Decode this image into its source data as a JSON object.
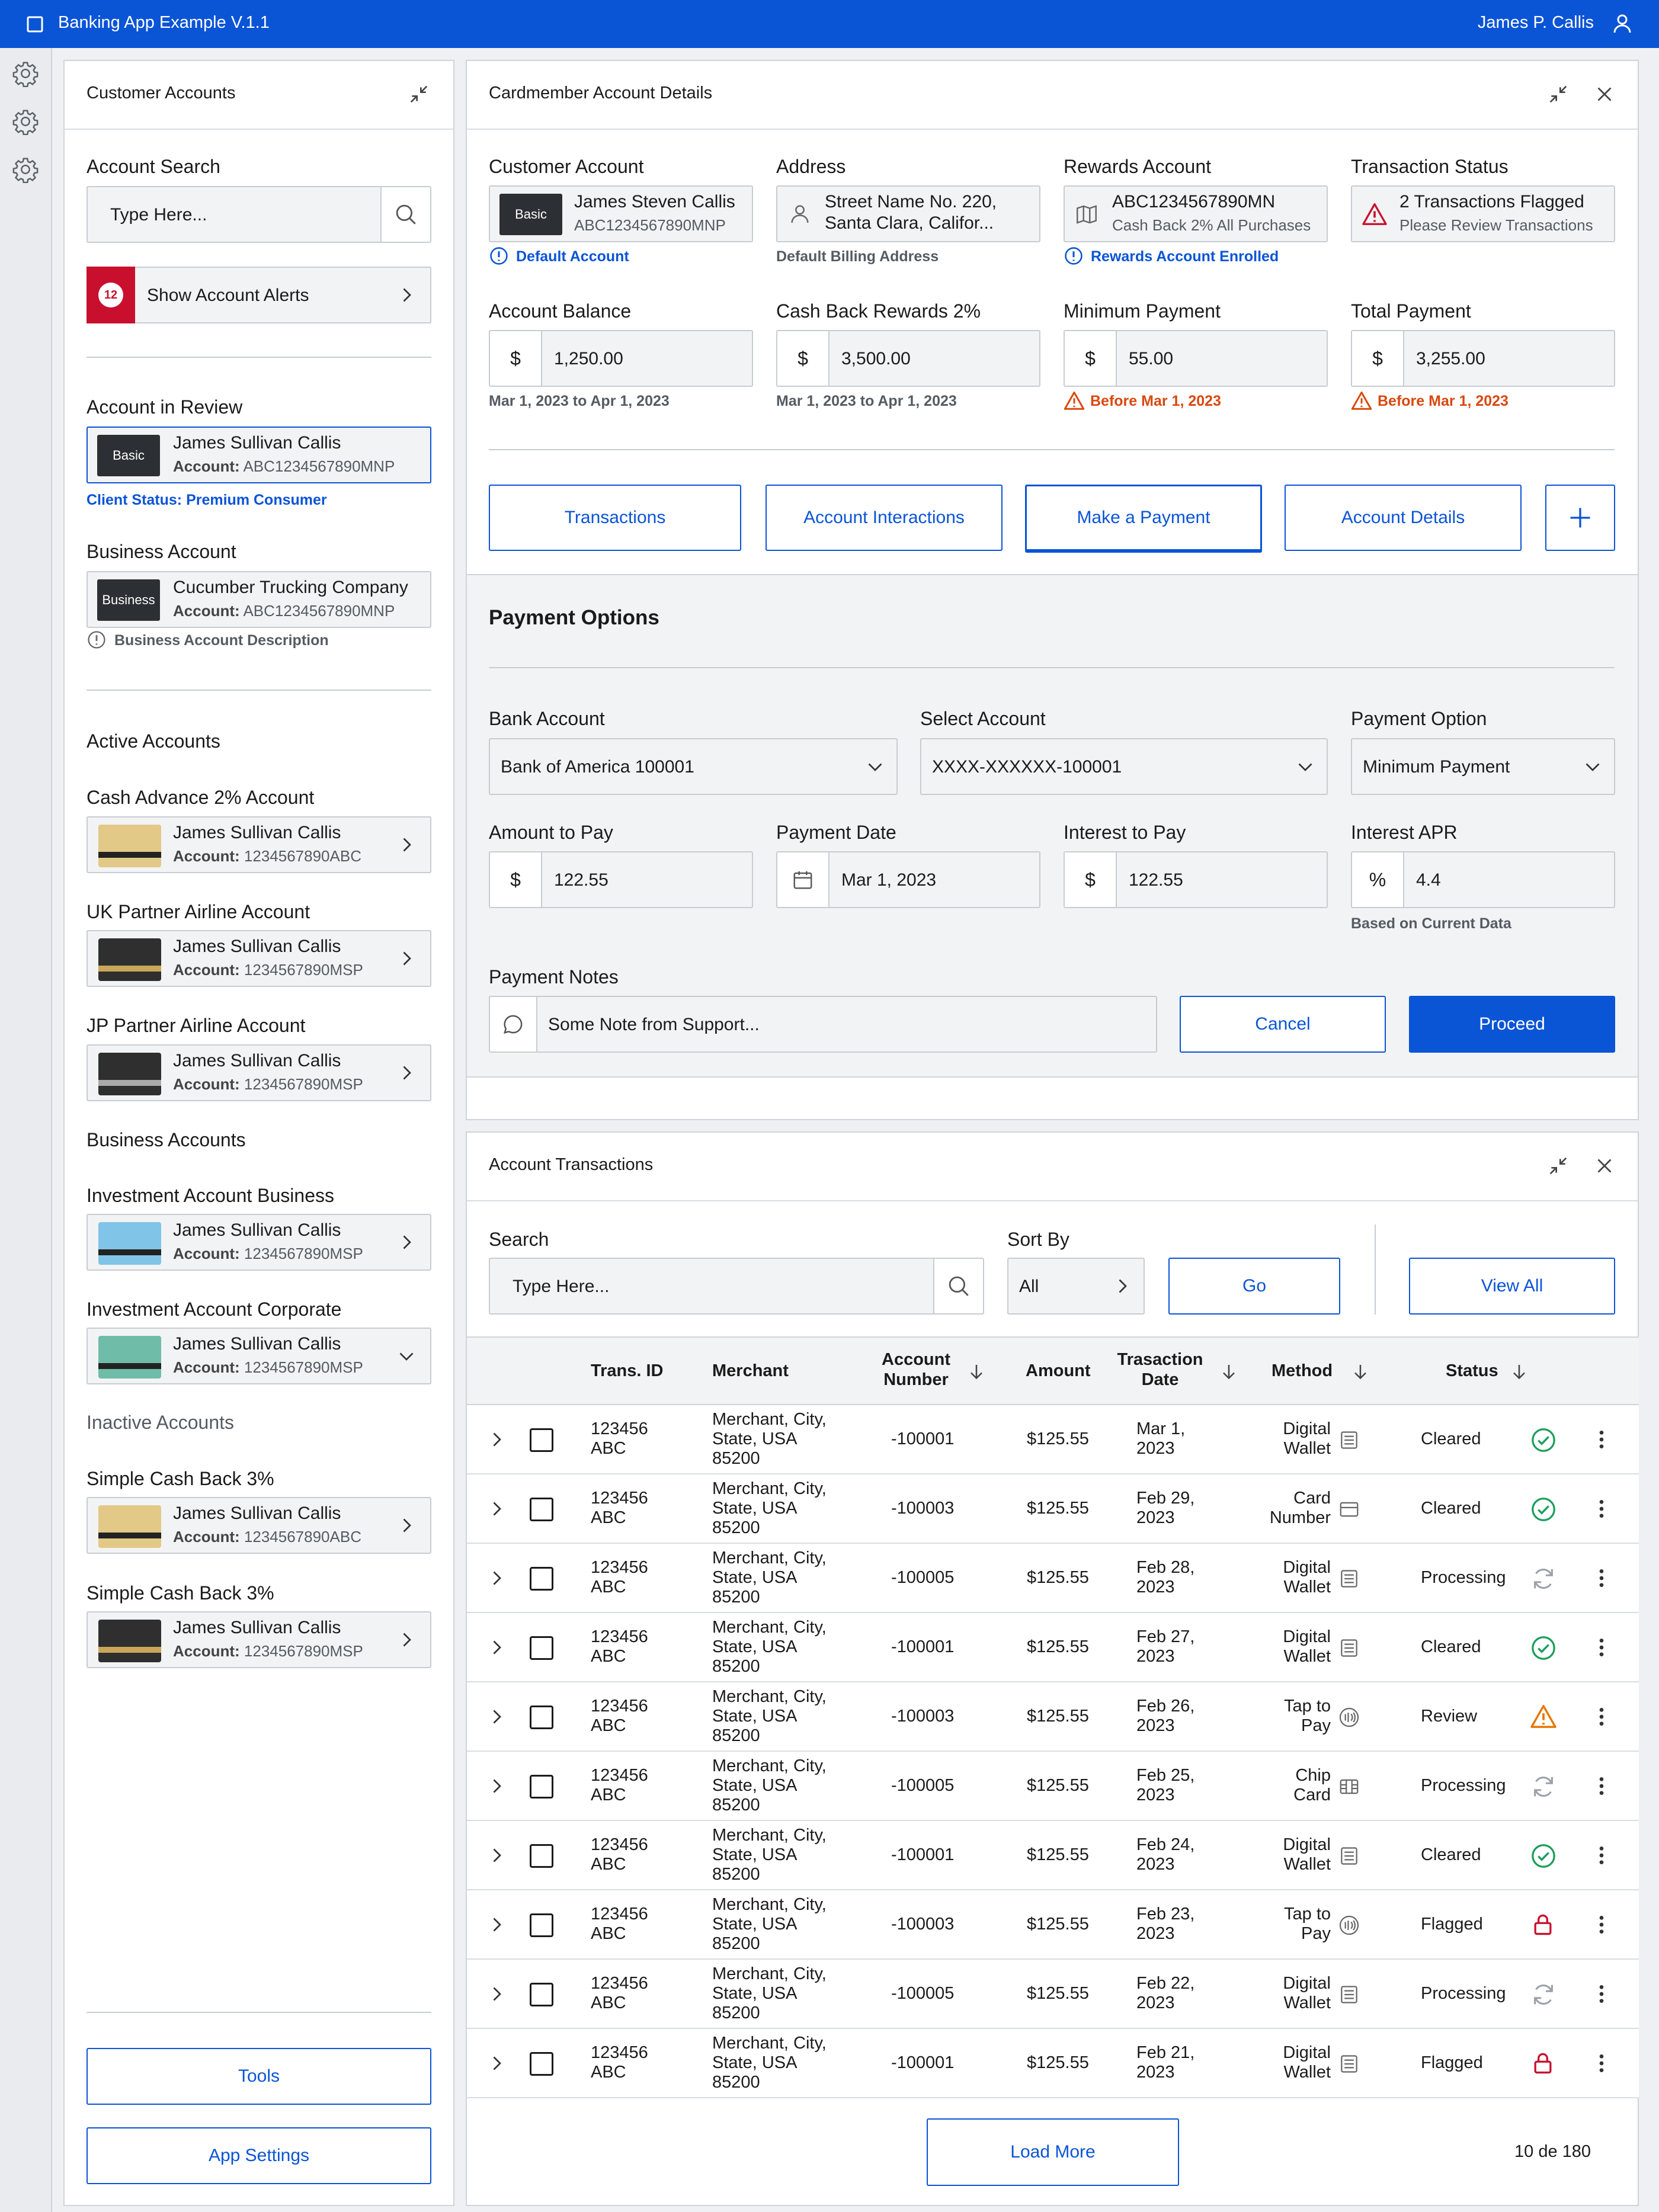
{
  "app": {
    "title": "Banking App Example V.1.1",
    "user": "James P. Callis"
  },
  "colors": {
    "primary": "#0a54d6",
    "alert": "#c8102e",
    "warning": "#d9480f",
    "success": "#1a9e5c"
  },
  "left": {
    "title": "Customer Accounts",
    "search_label": "Account Search",
    "search_placeholder": "Type Here...",
    "alerts_count": "12",
    "alerts_label": "Show Account Alerts",
    "review_label": "Account in Review",
    "review_badge": "Basic",
    "review_name": "James Sullivan Callis",
    "account_prefix": "Account:",
    "review_account": "ABC1234567890MNP",
    "client_status": "Client Status: Premium Consumer",
    "business_label": "Business Account",
    "business_badge": "Business",
    "business_name": "Cucumber Trucking Company",
    "business_account": "ABC1234567890MNP",
    "business_desc": "Business Account Description",
    "active_heading": "Active Accounts",
    "business_heading": "Business Accounts",
    "inactive_heading": "Inactive Accounts",
    "accounts": [
      {
        "title": "Cash Advance 2% Account",
        "name": "James Sullivan Callis",
        "number": "1234567890ABC"
      },
      {
        "title": "UK Partner Airline Account",
        "name": "James Sullivan Callis",
        "number": "1234567890MSP"
      },
      {
        "title": "JP Partner Airline Account",
        "name": "James Sullivan Callis",
        "number": "1234567890MSP"
      },
      {
        "title": "Investment Account Business",
        "name": "James Sullivan Callis",
        "number": "1234567890MSP"
      },
      {
        "title": "Investment Account Corporate",
        "name": "James Sullivan Callis",
        "number": "1234567890MSP"
      },
      {
        "title": "Simple Cash Back 3%",
        "name": "James Sullivan Callis",
        "number": "1234567890ABC"
      },
      {
        "title": "Simple Cash Back 3%",
        "name": "James Sullivan Callis",
        "number": "1234567890MSP"
      }
    ],
    "tools": "Tools",
    "app_settings": "App Settings"
  },
  "details": {
    "title": "Cardmember Account Details",
    "customer_label": "Customer Account",
    "customer_badge": "Basic",
    "customer_name": "James Steven Callis",
    "customer_number": "ABC1234567890MNP",
    "default_account": "Default Account",
    "address_label": "Address",
    "address_line1": "Street Name No. 220,",
    "address_line2": "Santa Clara, Califor...",
    "default_billing": "Default Billing Address",
    "rewards_label": "Rewards Account",
    "rewards_number": "ABC1234567890MN",
    "rewards_desc": "Cash Back 2% All Purchases",
    "rewards_enrolled": "Rewards Account Enrolled",
    "status_label": "Transaction Status",
    "status_line1": "2 Transactions Flagged",
    "status_line2": "Please Review Transactions",
    "balance_label": "Account Balance",
    "balance_value": "1,250.00",
    "balance_period": "Mar 1, 2023 to Apr 1, 2023",
    "cashback_label": "Cash Back Rewards 2%",
    "cashback_value": "3,500.00",
    "cashback_period": "Mar 1, 2023 to Apr 1, 2023",
    "min_label": "Minimum Payment",
    "min_value": "55.00",
    "min_due": "Before Mar 1, 2023",
    "total_label": "Total Payment",
    "total_value": "3,255.00",
    "total_due": "Before Mar 1, 2023",
    "currency": "$",
    "tabs": [
      "Transactions",
      "Account Interactions",
      "Make a Payment",
      "Account Details"
    ]
  },
  "payment": {
    "title": "Payment Options",
    "bank_label": "Bank Account",
    "bank_value": "Bank of America 100001",
    "select_label": "Select Account",
    "select_value": "XXXX-XXXXXX-100001",
    "option_label": "Payment Option",
    "option_value": "Minimum Payment",
    "amount_label": "Amount to Pay",
    "amount_value": "122.55",
    "date_label": "Payment Date",
    "date_value": "Mar 1, 2023",
    "interest_label": "Interest to Pay",
    "interest_value": "122.55",
    "apr_label": "Interest APR",
    "apr_prefix": "%",
    "apr_value": "4.4",
    "apr_note": "Based on Current Data",
    "notes_label": "Payment Notes",
    "notes_value": "Some Note from Support...",
    "cancel": "Cancel",
    "proceed": "Proceed"
  },
  "transactions": {
    "title": "Account Transactions",
    "search_label": "Search",
    "search_placeholder": "Type Here...",
    "sort_label": "Sort By",
    "sort_value": "All",
    "go": "Go",
    "view_all": "View All",
    "headers": {
      "trans_id": "Trans. ID",
      "merchant": "Merchant",
      "account_l1": "Account",
      "account_l2": "Number",
      "amount": "Amount",
      "date_l1": "Trasaction",
      "date_l2": "Date",
      "method": "Method",
      "status": "Status"
    },
    "rows": [
      {
        "id1": "123456",
        "id2": "ABC",
        "m1": "Merchant, City,",
        "m2": "State, USA",
        "m3": "85200",
        "acct": "-100001",
        "amount": "$125.55",
        "d1": "Mar 1,",
        "d2": "2023",
        "meth1": "Digital",
        "meth2": "Wallet",
        "meth_icon": "wallet-icon",
        "status": "Cleared",
        "status_icon": "check-circle-icon"
      },
      {
        "id1": "123456",
        "id2": "ABC",
        "m1": "Merchant, City,",
        "m2": "State, USA",
        "m3": "85200",
        "acct": "-100003",
        "amount": "$125.55",
        "d1": "Feb 29,",
        "d2": "2023",
        "meth1": "Card",
        "meth2": "Number",
        "meth_icon": "card-icon",
        "status": "Cleared",
        "status_icon": "check-circle-icon"
      },
      {
        "id1": "123456",
        "id2": "ABC",
        "m1": "Merchant, City,",
        "m2": "State, USA",
        "m3": "85200",
        "acct": "-100005",
        "amount": "$125.55",
        "d1": "Feb 28,",
        "d2": "2023",
        "meth1": "Digital",
        "meth2": "Wallet",
        "meth_icon": "wallet-icon",
        "status": "Processing",
        "status_icon": "refresh-icon"
      },
      {
        "id1": "123456",
        "id2": "ABC",
        "m1": "Merchant, City,",
        "m2": "State, USA",
        "m3": "85200",
        "acct": "-100001",
        "amount": "$125.55",
        "d1": "Feb 27,",
        "d2": "2023",
        "meth1": "Digital",
        "meth2": "Wallet",
        "meth_icon": "wallet-icon",
        "status": "Cleared",
        "status_icon": "check-circle-icon"
      },
      {
        "id1": "123456",
        "id2": "ABC",
        "m1": "Merchant, City,",
        "m2": "State, USA",
        "m3": "85200",
        "acct": "-100003",
        "amount": "$125.55",
        "d1": "Feb 26,",
        "d2": "2023",
        "meth1": "Tap to",
        "meth2": "Pay",
        "meth_icon": "contactless-icon",
        "status": "Review",
        "status_icon": "warning-icon"
      },
      {
        "id1": "123456",
        "id2": "ABC",
        "m1": "Merchant, City,",
        "m2": "State, USA",
        "m3": "85200",
        "acct": "-100005",
        "amount": "$125.55",
        "d1": "Feb 25,",
        "d2": "2023",
        "meth1": "Chip",
        "meth2": "Card",
        "meth_icon": "chip-icon",
        "status": "Processing",
        "status_icon": "refresh-icon"
      },
      {
        "id1": "123456",
        "id2": "ABC",
        "m1": "Merchant, City,",
        "m2": "State, USA",
        "m3": "85200",
        "acct": "-100001",
        "amount": "$125.55",
        "d1": "Feb 24,",
        "d2": "2023",
        "meth1": "Digital",
        "meth2": "Wallet",
        "meth_icon": "wallet-icon",
        "status": "Cleared",
        "status_icon": "check-circle-icon"
      },
      {
        "id1": "123456",
        "id2": "ABC",
        "m1": "Merchant, City,",
        "m2": "State, USA",
        "m3": "85200",
        "acct": "-100003",
        "amount": "$125.55",
        "d1": "Feb 23,",
        "d2": "2023",
        "meth1": "Tap to",
        "meth2": "Pay",
        "meth_icon": "contactless-icon",
        "status": "Flagged",
        "status_icon": "lock-icon"
      },
      {
        "id1": "123456",
        "id2": "ABC",
        "m1": "Merchant, City,",
        "m2": "State, USA",
        "m3": "85200",
        "acct": "-100005",
        "amount": "$125.55",
        "d1": "Feb 22,",
        "d2": "2023",
        "meth1": "Digital",
        "meth2": "Wallet",
        "meth_icon": "wallet-icon",
        "status": "Processing",
        "status_icon": "refresh-icon"
      },
      {
        "id1": "123456",
        "id2": "ABC",
        "m1": "Merchant, City,",
        "m2": "State, USA",
        "m3": "85200",
        "acct": "-100001",
        "amount": "$125.55",
        "d1": "Feb 21,",
        "d2": "2023",
        "meth1": "Digital",
        "meth2": "Wallet",
        "meth_icon": "wallet-icon",
        "status": "Flagged",
        "status_icon": "lock-icon"
      }
    ],
    "load_more": "Load More",
    "pagination": "10 de 180"
  }
}
